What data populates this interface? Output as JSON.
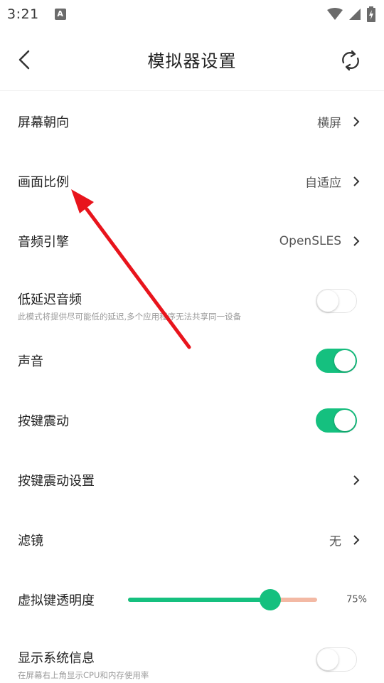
{
  "status_bar": {
    "time": "3:21",
    "notification_icon": "A"
  },
  "header": {
    "title": "模拟器设置"
  },
  "settings": [
    {
      "id": "screen-orientation",
      "label": "屏幕朝向",
      "value": "横屏",
      "control": "chevron"
    },
    {
      "id": "aspect-ratio",
      "label": "画面比例",
      "value": "自适应",
      "control": "chevron"
    },
    {
      "id": "audio-engine",
      "label": "音频引擎",
      "value": "OpenSLES",
      "control": "chevron"
    },
    {
      "id": "low-latency-audio",
      "label": "低延迟音频",
      "sub": "此模式将提供尽可能低的延迟,多个应用程序无法共享同一设备",
      "control": "toggle",
      "on": false
    },
    {
      "id": "sound",
      "label": "声音",
      "control": "toggle",
      "on": true
    },
    {
      "id": "key-vibration",
      "label": "按键震动",
      "control": "toggle",
      "on": true
    },
    {
      "id": "key-vibration-settings",
      "label": "按键震动设置",
      "control": "chevron"
    },
    {
      "id": "filter",
      "label": "滤镜",
      "value": "无",
      "control": "chevron"
    },
    {
      "id": "virtual-key-opacity",
      "label": "虚拟键透明度",
      "value": "75%",
      "control": "slider",
      "level": 0.75
    },
    {
      "id": "show-system-info",
      "label": "显示系统信息",
      "sub": "在屏幕右上角显示CPU和内存使用率",
      "control": "toggle",
      "on": false
    }
  ],
  "colors": {
    "accent": "#15c07f",
    "slider_remaining": "#f3b9a4",
    "annotation_arrow": "#e8141c"
  }
}
